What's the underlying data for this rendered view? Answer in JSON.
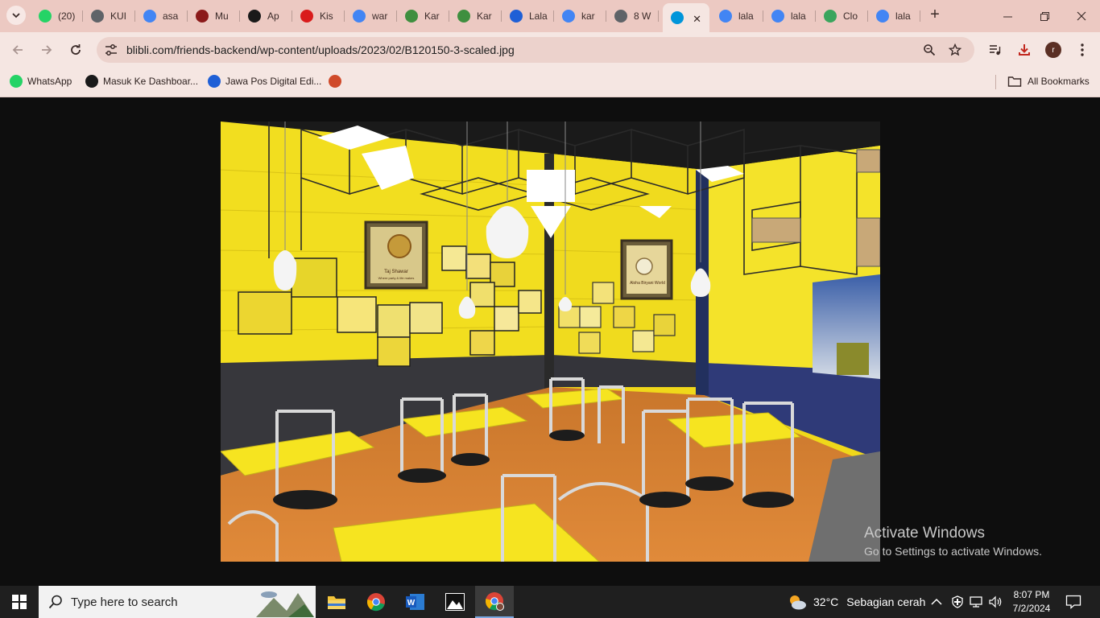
{
  "tabs": [
    {
      "label": "(20)",
      "favicon": "whatsapp-icon",
      "color": "#25d366"
    },
    {
      "label": "KUI",
      "favicon": "globe-icon",
      "color": "#5f6368"
    },
    {
      "label": "asa",
      "favicon": "google-icon",
      "color": "#4285f4"
    },
    {
      "label": "Mu",
      "favicon": "maroon-logo-icon",
      "color": "#8b1a1a"
    },
    {
      "label": "Ap",
      "favicon": "s-logo-icon",
      "color": "#1a1a1a"
    },
    {
      "label": "Kis",
      "favicon": "md-logo-icon",
      "color": "#d91c1c"
    },
    {
      "label": "war",
      "favicon": "google-icon",
      "color": "#4285f4"
    },
    {
      "label": "Kar",
      "favicon": "emblem-icon",
      "color": "#3f8f3f"
    },
    {
      "label": "Kar",
      "favicon": "emblem-icon",
      "color": "#3f8f3f"
    },
    {
      "label": "Lala",
      "favicon": "d-logo-icon",
      "color": "#1f5fd6"
    },
    {
      "label": "kar",
      "favicon": "google-icon",
      "color": "#4285f4"
    },
    {
      "label": "8 W",
      "favicon": "globe-icon",
      "color": "#5f6368"
    },
    {
      "label": "",
      "favicon": "blibli-icon",
      "color": "#0095da",
      "active": true
    },
    {
      "label": "lala",
      "favicon": "google-icon",
      "color": "#4285f4"
    },
    {
      "label": "lala",
      "favicon": "google-icon",
      "color": "#4285f4"
    },
    {
      "label": "Clo",
      "favicon": "cloud-leaf-icon",
      "color": "#3aa55d"
    },
    {
      "label": "lala",
      "favicon": "google-icon",
      "color": "#4285f4"
    }
  ],
  "address_bar": {
    "url": "blibli.com/friends-backend/wp-content/uploads/2023/02/B120150-3-scaled.jpg"
  },
  "bookmarks": [
    {
      "label": "WhatsApp",
      "icon": "whatsapp-icon",
      "color": "#25d366"
    },
    {
      "label": "Masuk Ke Dashboar...",
      "icon": "dashboard-logo-icon",
      "color": "#1a1a1a"
    },
    {
      "label": "Jawa Pos Digital Edi...",
      "icon": "jp-logo-icon",
      "color": "#1f5fd6"
    },
    {
      "label": "",
      "icon": "jdih-logo-icon",
      "color": "#d04a2a"
    }
  ],
  "all_bookmarks_label": "All Bookmarks",
  "profile_initial": "r",
  "watermark": {
    "title": "Activate Windows",
    "subtitle": "Go to Settings to activate Windows."
  },
  "taskbar": {
    "search_placeholder": "Type here to search",
    "weather_temp": "32°C",
    "weather_desc": "Sebagian cerah",
    "time": "8:07 PM",
    "date": "7/2/2024"
  },
  "photo": {
    "poster_left_line1": "Taj Shawar",
    "poster_left_line2": "Where party & life makes",
    "poster_right_line1": "Aloha Biryani World"
  }
}
